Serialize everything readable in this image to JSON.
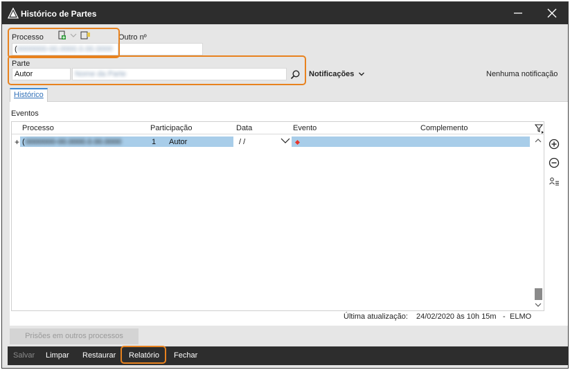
{
  "window": {
    "title": "Histórico de Partes"
  },
  "processo": {
    "label": "Processo",
    "value": "(",
    "value_blurred": "0000000-00.0000.0.00.0000",
    "outro_label": "Outro nº",
    "outro_value": ""
  },
  "parte": {
    "label": "Parte",
    "type_value": "Autor",
    "name_value": "Nome da Parte",
    "notificacoes_label": "Notificações",
    "notification_status": "Nenhuma notificação"
  },
  "tabs": [
    {
      "label": "Histórico"
    }
  ],
  "eventos": {
    "label": "Eventos",
    "columns": [
      "Processo",
      "Participação",
      "Data",
      "Evento",
      "Complemento"
    ],
    "rows": [
      {
        "expand": "+",
        "processo": "(",
        "processo_blurred": "0000000-00.0000.0.00.0000",
        "participacao_num": "1",
        "participacao": "Autor",
        "data": " / /",
        "evento": "",
        "complemento": ""
      }
    ]
  },
  "footer_status": {
    "label": "Última atualização:",
    "value": "24/02/2020 às 10h 15m",
    "separator": "-",
    "user": "ELMO"
  },
  "buttons": {
    "prisoes": "Prisões em outros processos",
    "salvar": "Salvar",
    "limpar": "Limpar",
    "restaurar": "Restaurar",
    "relatorio": "Relatório",
    "fechar": "Fechar"
  },
  "colors": {
    "highlight": "#e8821e",
    "selection": "#a8cde9",
    "titlebar": "#2d2d2d",
    "tab_accent": "#3d8ad6"
  },
  "icons": [
    "app-logo-icon",
    "minimize-icon",
    "close-icon",
    "new-document-icon",
    "dropdown-arrow-icon",
    "note-icon",
    "search-icon",
    "chevron-down-icon",
    "filter-icon",
    "add-circle-icon",
    "remove-circle-icon",
    "user-list-icon",
    "scroll-up-icon",
    "scroll-down-icon",
    "event-marker-icon"
  ]
}
